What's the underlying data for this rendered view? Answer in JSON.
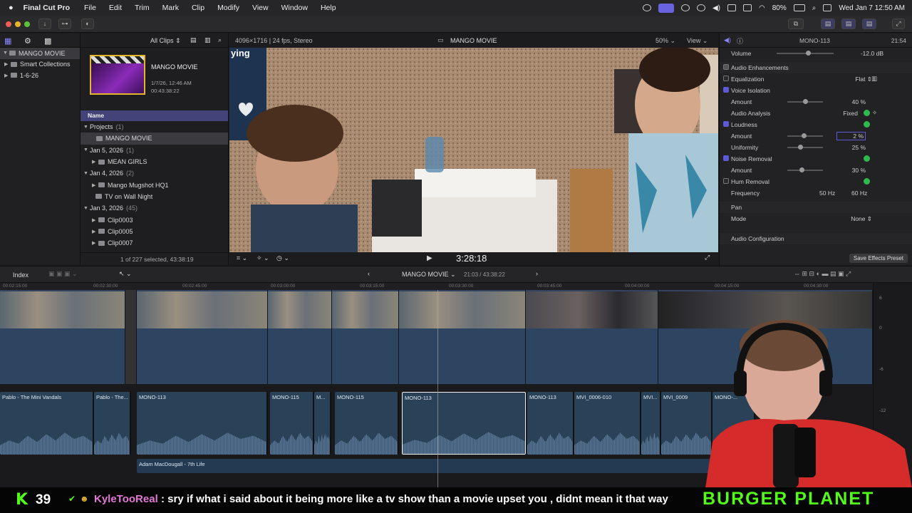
{
  "menubar": {
    "app": "Final Cut Pro",
    "items": [
      "File",
      "Edit",
      "Trim",
      "Mark",
      "Clip",
      "Modify",
      "View",
      "Window",
      "Help"
    ],
    "battery": "80%",
    "datetime": "Wed Jan 7  12:50 AM"
  },
  "library": {
    "name": "MANGO MOVIE",
    "items": [
      "Smart Collections",
      "1-6-26"
    ]
  },
  "browser": {
    "filter": "All Clips",
    "card": {
      "title": "MANGO MOVIE",
      "date": "1/7/26, 12:46 AM",
      "duration": "00:43:38:22"
    },
    "name_col": "Name",
    "projects_label": "Projects",
    "projects_count": "(1)",
    "project_item": "MANGO MOVIE",
    "groups": [
      {
        "date": "Jan 5, 2026",
        "count": "(1)",
        "items": [
          "MEAN GIRLS"
        ]
      },
      {
        "date": "Jan 4, 2026",
        "count": "(2)",
        "items": [
          "Mango Mugshot HQ1",
          "TV on Wall Night"
        ]
      },
      {
        "date": "Jan 3, 2026",
        "count": "(45)",
        "items": [
          "Clip0003",
          "Clip0005",
          "Clip0007"
        ]
      }
    ],
    "footer": "1 of 227 selected, 43:38:19"
  },
  "viewer": {
    "format": "4096×1716 | 24 fps, Stereo",
    "title": "MANGO MOVIE",
    "zoom": "50%",
    "view": "View",
    "timecode": "3:28:18",
    "overlay_text": "ying"
  },
  "inspector": {
    "clip": "MONO-113",
    "time": "21:54",
    "volume_label": "Volume",
    "volume_value": "-12.0",
    "volume_unit": "dB",
    "enhancements": "Audio Enhancements",
    "eq_label": "Equalization",
    "eq_value": "Flat",
    "vi_label": "Voice Isolation",
    "vi_amount_label": "Amount",
    "vi_amount": "40",
    "pct": "%",
    "analysis_label": "Audio Analysis",
    "analysis_value": "Fixed",
    "loud_label": "Loudness",
    "loud_amount_label": "Amount",
    "loud_amount": "2",
    "uni_label": "Uniformity",
    "uni_value": "25",
    "nr_label": "Noise Removal",
    "nr_amount_label": "Amount",
    "nr_amount": "30",
    "hum_label": "Hum Removal",
    "freq_label": "Frequency",
    "freq_50": "50 Hz",
    "freq_60": "60 Hz",
    "pan_label": "Pan",
    "mode_label": "Mode",
    "mode_value": "None",
    "config_label": "Audio Configuration",
    "save_btn": "Save Effects Preset",
    "slider_levels": {
      "volume": 0.55,
      "vi": 0.5,
      "loud": 0.45,
      "uni": 0.35,
      "nr": 0.4
    }
  },
  "timeline": {
    "index": "Index",
    "project": "MANGO MOVIE",
    "tc": "21:03 / 43:38:22",
    "ruler": [
      "00:02:15:00",
      "00:02:30:00",
      "00:02:45:00",
      "00:03:00:00",
      "00:03:15:00",
      "00:03:30:00",
      "00:03:45:00",
      "00:04:00:00",
      "00:04:15:00",
      "00:04:30:00"
    ],
    "audio_clips": [
      "Pablo - The Mini Vandals",
      "Pablo - The...",
      "MONO-113",
      "MONO-115",
      "M...",
      "MONO-115",
      "MONO-113",
      "MONO-113",
      "MVI_0006-010",
      "MVI...",
      "MVI_0009",
      "MONO-..."
    ],
    "music": "Adam MacDougall - 7th Life",
    "meter_labels": [
      "6",
      "0",
      "-6",
      "-12"
    ]
  },
  "chat": {
    "count": "39",
    "user": "KyleTooReal",
    "message": ": sry if what i said about it being more like a tv show than a movie upset you , didnt mean it that way",
    "brand": "BURGER PLANET"
  }
}
